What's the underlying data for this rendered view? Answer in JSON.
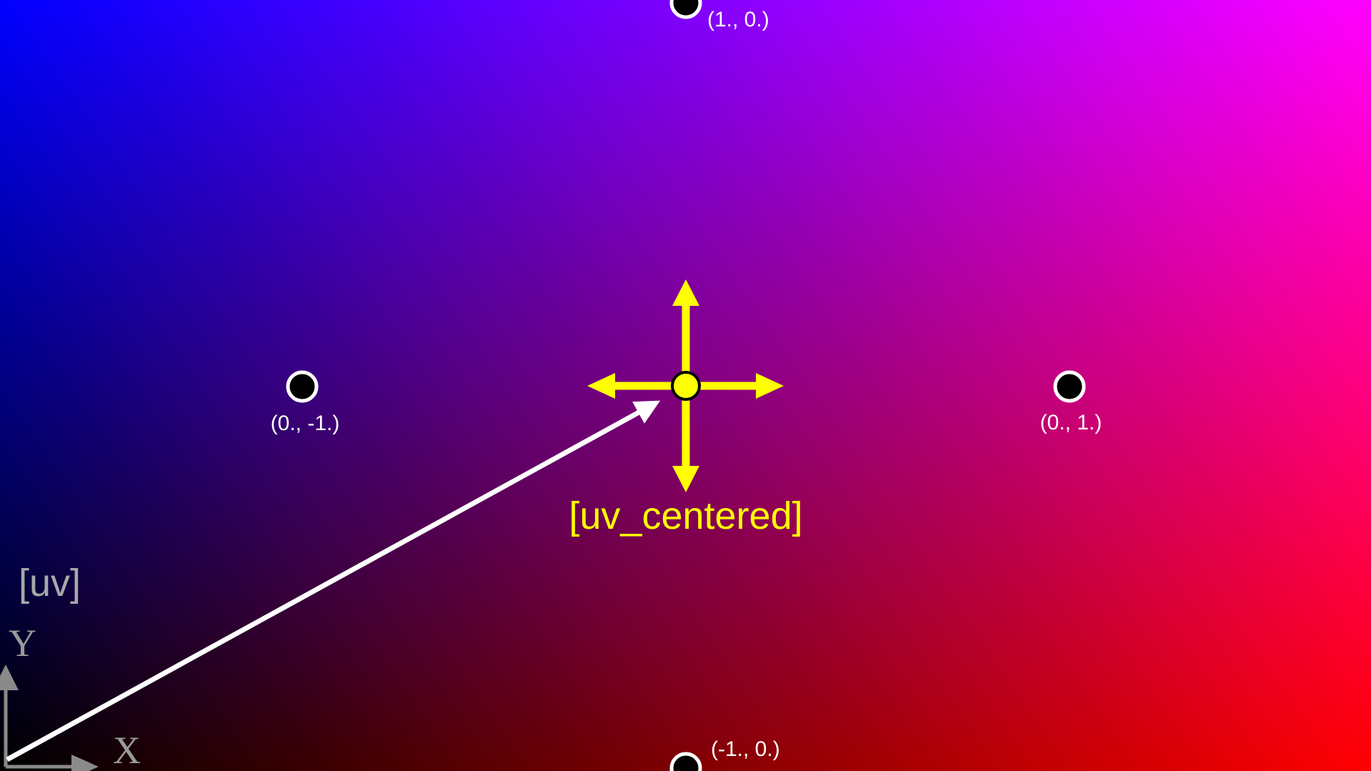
{
  "diagram": {
    "center_label": "[uv_centered]",
    "origin_label": "[uv]",
    "axis_x_label": "X",
    "axis_y_label": "Y",
    "points": {
      "top": "(1., 0.)",
      "bottom": "(-1., 0.)",
      "left": "(0., -1.)",
      "right": "(0., 1.)"
    },
    "colors": {
      "bottom_left": "#000000",
      "bottom_right": "#ff0000",
      "top_left": "#0000ff",
      "top_right": "#ff00ff",
      "center_accent": "#ffff00",
      "vector": "#ffffff",
      "axis": "#8a8a8a"
    }
  }
}
